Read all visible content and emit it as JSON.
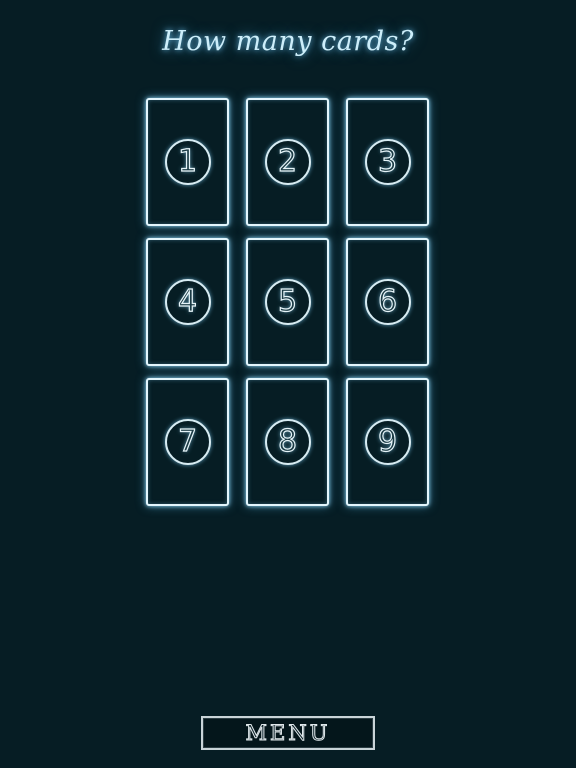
{
  "title": "How many cards?",
  "cards": [
    "1",
    "2",
    "3",
    "4",
    "5",
    "6",
    "7",
    "8",
    "9"
  ],
  "menu": {
    "label": "MENU"
  },
  "colors": {
    "background": "#061d24",
    "glow": "#cdeefa",
    "card_border": "#e3f6fd"
  }
}
